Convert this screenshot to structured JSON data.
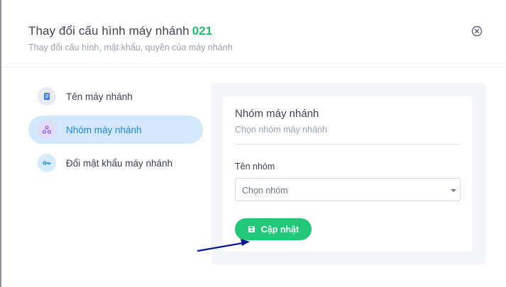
{
  "modal": {
    "title": "Thay đổi cấu hình máy nhánh",
    "extension_code": "021",
    "subtitle": "Thay đổi cấu hình, mật khẩu, quyền của máy nhánh"
  },
  "sidebar": {
    "items": [
      {
        "label": "Tên máy nhánh",
        "icon": "notebook-icon",
        "active": false
      },
      {
        "label": "Nhóm máy nhánh",
        "icon": "group-nodes-icon",
        "active": true
      },
      {
        "label": "Đổi mật khẩu máy nhánh",
        "icon": "key-icon",
        "active": false
      }
    ]
  },
  "card": {
    "title": "Nhóm máy nhánh",
    "subtitle": "Chọn nhóm máy nhánh",
    "group_field": {
      "label": "Tên nhóm",
      "selected_value": "Chọn nhóm"
    },
    "update_button": {
      "label": "Cập nhật",
      "icon": "save-icon"
    }
  },
  "colors": {
    "accent_blue": "#1e88e5",
    "active_nav_bg": "#d3e8fb",
    "success_green": "#22c777",
    "code_green": "#1bc56b",
    "annotation_arrow": "#0a1a8c"
  }
}
